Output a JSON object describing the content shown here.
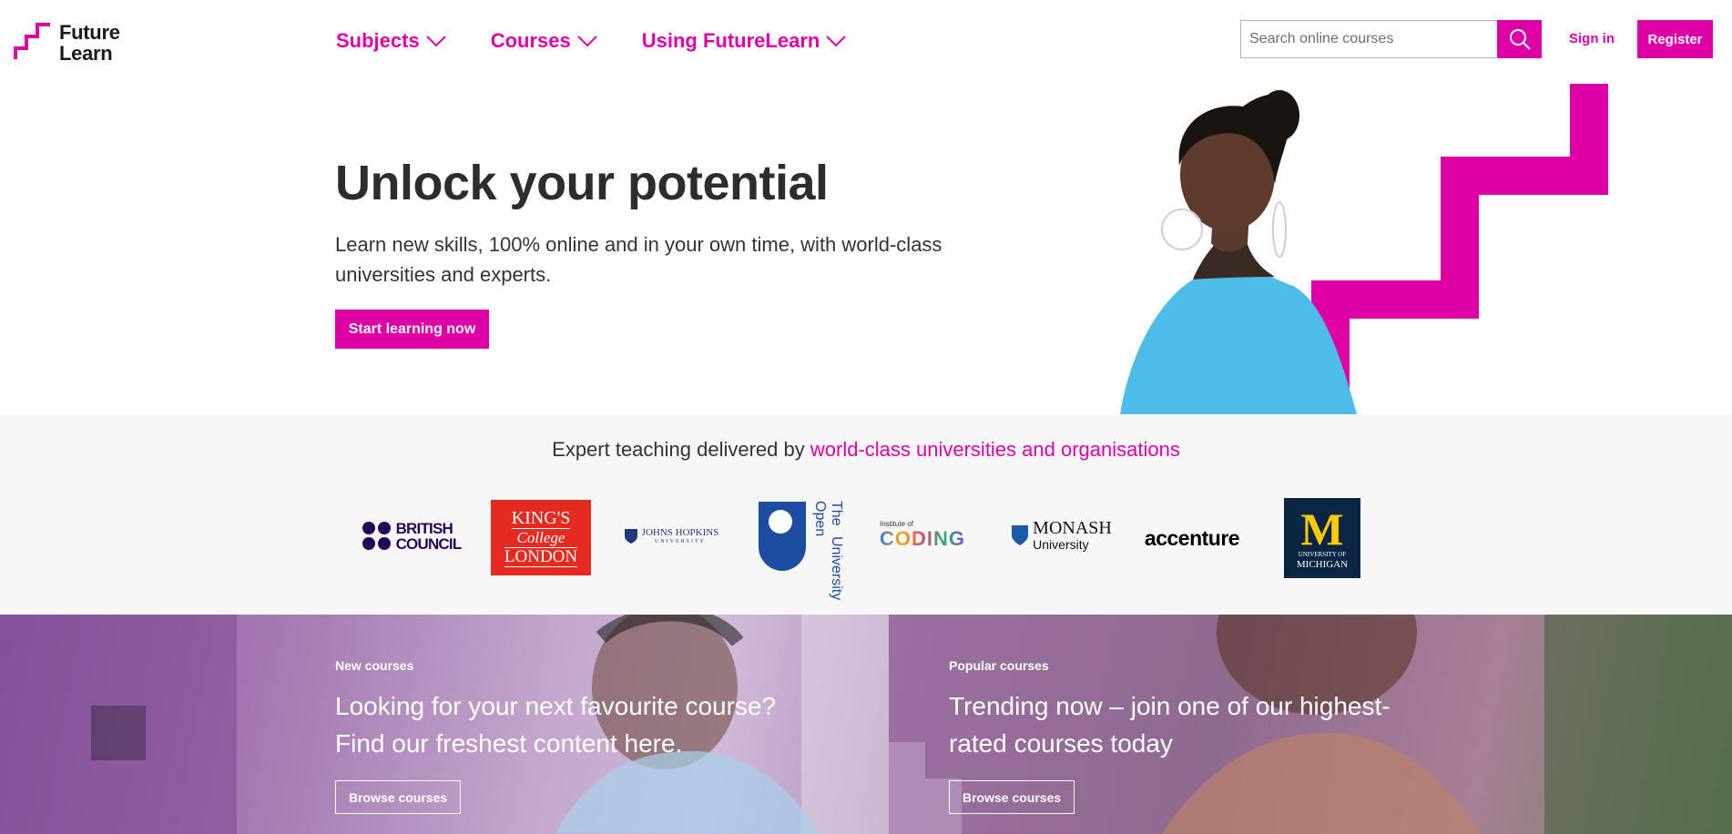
{
  "brand": {
    "line1": "Future",
    "line2": "Learn",
    "accent": "#de00a5"
  },
  "nav": [
    {
      "label": "Subjects"
    },
    {
      "label": "Courses"
    },
    {
      "label": "Using FutureLearn"
    }
  ],
  "search": {
    "placeholder": "Search online courses",
    "value": ""
  },
  "auth": {
    "signin": "Sign in",
    "register": "Register"
  },
  "hero": {
    "title": "Unlock your potential",
    "subtitle": "Learn new skills, 100% online and in your own time, with world-class universities and experts.",
    "cta": "Start learning now"
  },
  "partners": {
    "heading": "Expert teaching delivered by ",
    "heading_link": "world-class universities and organisations",
    "logos": {
      "british_council": {
        "line1": "BRITISH",
        "line2": "COUNCIL"
      },
      "kings": {
        "line1": "KING'S",
        "line2": "College",
        "line3": "LONDON"
      },
      "jhu": {
        "line1": "JOHNS HOPKINS",
        "line2": "UNIVERSITY"
      },
      "open": {
        "line1": "The Open",
        "line2": "University"
      },
      "coding": {
        "line1": "Institute of",
        "line2": "CODING"
      },
      "monash": {
        "line1": "MONASH",
        "line2": "University"
      },
      "accenture": {
        "name": "accenture"
      },
      "michigan": {
        "letter": "M",
        "line1": "UNIVERSITY OF",
        "line2": "MICHIGAN"
      }
    }
  },
  "promos": [
    {
      "label": "New courses",
      "text": "Looking for your next favourite course? Find our freshest content here.",
      "button": "Browse courses"
    },
    {
      "label": "Popular courses",
      "text": "Trending now – join one of our highest-rated courses today",
      "button": "Browse courses"
    }
  ]
}
